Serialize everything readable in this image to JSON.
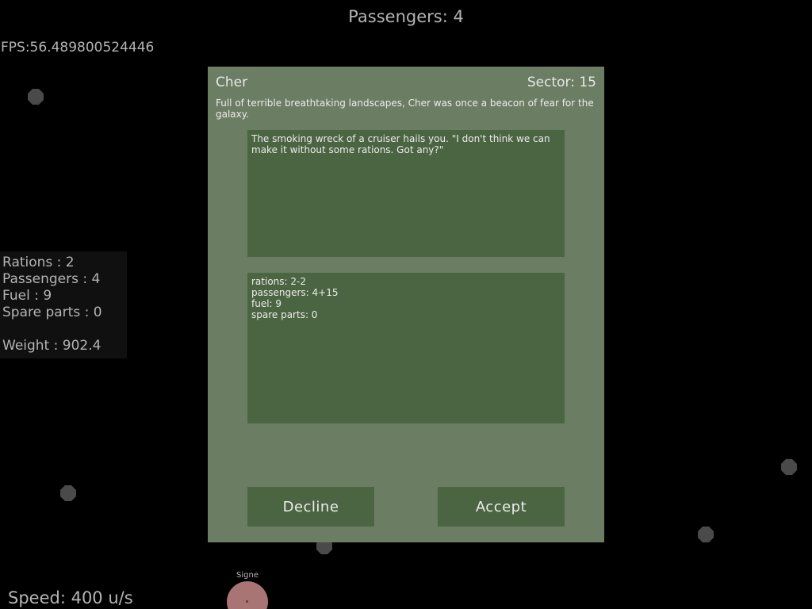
{
  "hud": {
    "passengers_text": "Passengers: 4",
    "fps_text": "FPS:56.489800524446",
    "speed_text": "Speed: 400 u/s"
  },
  "stats": {
    "rations": "Rations : 2",
    "passengers": "Passengers : 4",
    "fuel": "Fuel : 9",
    "spare_parts": "Spare parts : 0",
    "weight": "Weight : 902.4"
  },
  "map": {
    "planet_label": "Signe",
    "asteroid_icon": "asteroid-icon",
    "planet_color": "#a87474",
    "asteroid_color": "#4a4a4a"
  },
  "dialog": {
    "planet_name": "Cher",
    "sector": "Sector: 15",
    "description": "Full of terrible breathtaking landscapes, Cher was once a beacon of fear for the galaxy.",
    "message": "The smoking wreck of a cruiser hails you. \"I don't think we can make it without some rations. Got any?\"",
    "resources": [
      "rations: 2-2",
      "passengers: 4+15",
      "fuel: 9",
      "spare parts: 0"
    ],
    "decline_label": "Decline",
    "accept_label": "Accept",
    "panel_color": "#6b7d63",
    "box_color": "#4b6542"
  }
}
